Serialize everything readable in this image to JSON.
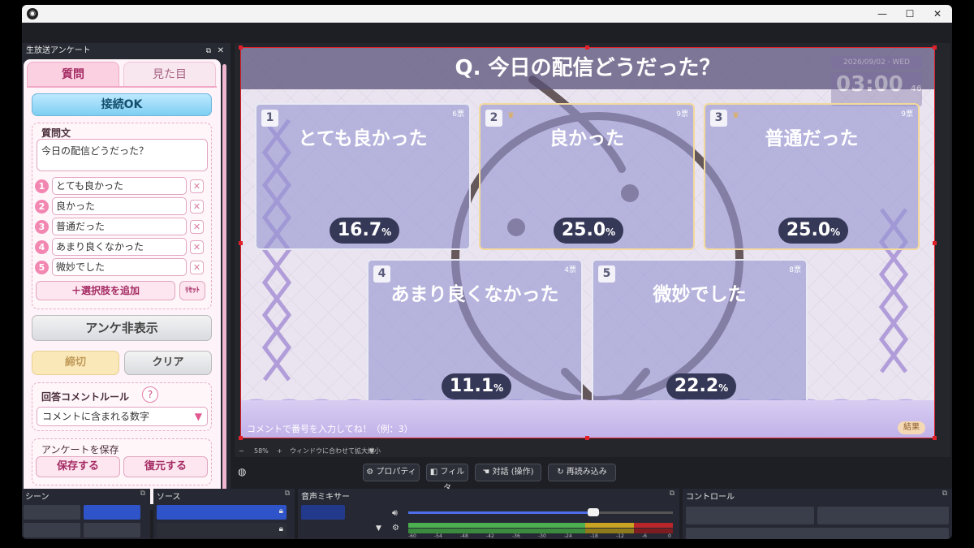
{
  "window": {
    "logo": "obs-icon",
    "minimize": "—",
    "maximize": "☐",
    "close": "✕"
  },
  "plugin_dock": {
    "title": "生放送アンケート",
    "tabs": {
      "question": "質問",
      "look": "見た目"
    },
    "connect_button": "接続OK",
    "question_label": "質問文",
    "question_text": "今日の配信どうだった？",
    "options": [
      {
        "num": "1",
        "text": "とても良かった"
      },
      {
        "num": "2",
        "text": "良かった"
      },
      {
        "num": "3",
        "text": "普通だった"
      },
      {
        "num": "4",
        "text": "あまり良くなかった"
      },
      {
        "num": "5",
        "text": "微妙でした"
      }
    ],
    "add_option": "＋選択肢を追加",
    "reset": "ﾘｾｯﾄ",
    "hide_button": "アンケ非表示",
    "close_button": "締切",
    "clear_button": "クリア",
    "comment_rule_label": "回答コメントルール",
    "help": "?",
    "comment_rule_value": "コメントに含まれる数字",
    "save_label": "アンケートを保存",
    "save_button": "保存する",
    "restore_button": "復元する"
  },
  "preview": {
    "title": "Q. 今日の配信どうだった？",
    "clock_date": "2026/09/02 · WED",
    "clock_time": "03:00",
    "clock_sec": "46",
    "results": [
      {
        "num": "1",
        "label": "とても良かった",
        "votes": "6票",
        "pct": "16.7",
        "winner": false
      },
      {
        "num": "2",
        "label": "良かった",
        "votes": "9票",
        "pct": "25.0",
        "winner": true
      },
      {
        "num": "3",
        "label": "普通だった",
        "votes": "9票",
        "pct": "25.0",
        "winner": true
      },
      {
        "num": "4",
        "label": "あまり良くなかった",
        "votes": "4票",
        "pct": "11.1",
        "winner": false
      },
      {
        "num": "5",
        "label": "微妙でした",
        "votes": "8票",
        "pct": "22.2",
        "winner": false
      }
    ],
    "pct_unit": "%",
    "hint": "コメントで番号を入力してね！（例：3）",
    "result_badge": "結果"
  },
  "zoom": {
    "minus": "−",
    "level": "58%",
    "plus": "+",
    "fit": "ウィンドウに合わせて拡大縮小"
  },
  "toolbar": {
    "properties": "プロパティ",
    "filters": "フィルタ",
    "interact": "対話 (操作)",
    "reload": "再読み込み"
  },
  "docks": {
    "scenes": "シーン",
    "sources": "ソース",
    "mixer": "音声ミキサー",
    "controls": "コントロール"
  },
  "mixer_ticks": [
    "-60",
    "-54",
    "-48",
    "-42",
    "-36",
    "-30",
    "-24",
    "-18",
    "-12",
    "-6",
    "0"
  ],
  "mixer_volume": 0.7,
  "colors": {
    "accent_pink": "#f287b1",
    "selection_red": "#e0202a",
    "obs_blue": "#2f53c8"
  }
}
